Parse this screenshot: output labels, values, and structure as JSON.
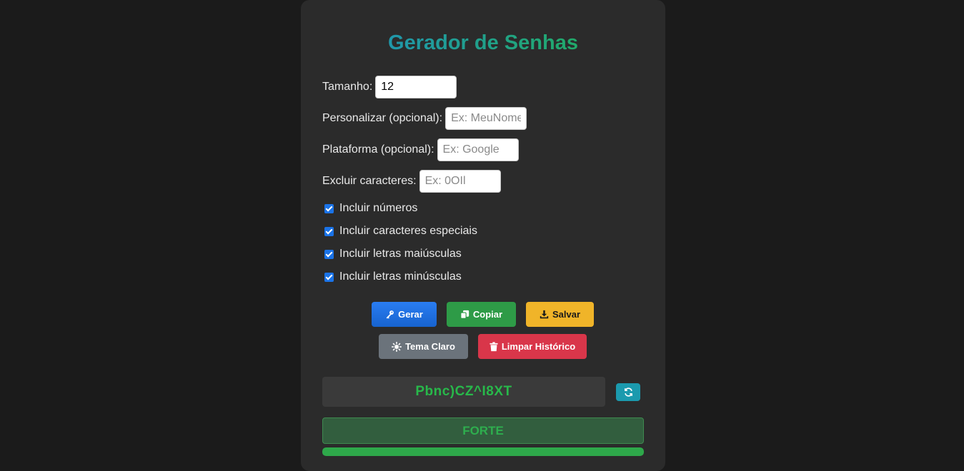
{
  "app": {
    "title": "Gerador de Senhas"
  },
  "fields": {
    "length": {
      "label": "Tamanho:",
      "value": "12"
    },
    "custom": {
      "label": "Personalizar (opcional):",
      "placeholder": "Ex: MeuNome"
    },
    "platform": {
      "label": "Plataforma (opcional):",
      "placeholder": "Ex: Google"
    },
    "exclude": {
      "label": "Excluir caracteres:",
      "placeholder": "Ex: 0OIl"
    }
  },
  "options": [
    {
      "label": "Incluir números",
      "checked": true
    },
    {
      "label": "Incluir caracteres especiais",
      "checked": true
    },
    {
      "label": "Incluir letras maiúsculas",
      "checked": true
    },
    {
      "label": "Incluir letras minúsculas",
      "checked": true
    }
  ],
  "buttons": {
    "generate": {
      "label": "Gerar",
      "icon": "key-icon"
    },
    "copy": {
      "label": "Copiar",
      "icon": "copy-icon"
    },
    "save": {
      "label": "Salvar",
      "icon": "download-icon"
    },
    "theme": {
      "label": "Tema Claro",
      "icon": "sun-icon"
    },
    "clear": {
      "label": "Limpar Histórico",
      "icon": "trash-icon"
    }
  },
  "result": {
    "password": "Pbnc)CZ^I8XT",
    "refresh_icon": "refresh-icon"
  },
  "strength": {
    "label": "FORTE",
    "level": 1.0
  },
  "colors": {
    "background": "#1b1b1b",
    "card": "#2b2b2b",
    "title_gradient_start": "#1f8fc9",
    "title_gradient_end": "#22b24c",
    "primary": "#1a73e8",
    "success": "#2e9b47",
    "warning": "#f0b429",
    "secondary": "#6b737b",
    "danger": "#d9364a",
    "info": "#1b9aae",
    "password_text": "#28b84a"
  }
}
